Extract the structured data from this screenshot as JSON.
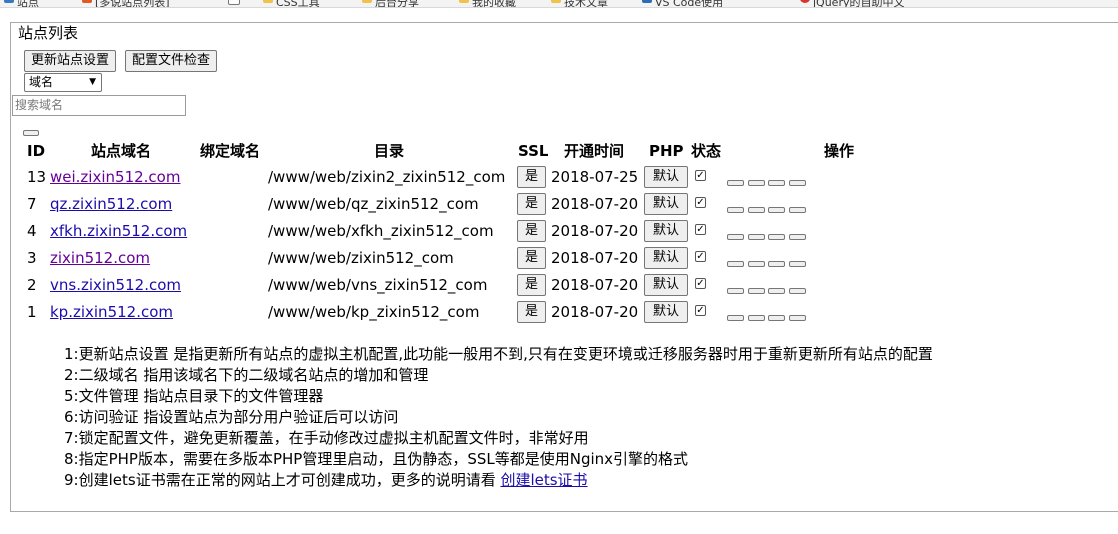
{
  "bookmarks": [
    "站点",
    "[多说站点列表]",
    "CSS工具",
    "后台分享",
    "我的收藏",
    "技术文章",
    "VS Code使用",
    "jQuery的自助中文"
  ],
  "legend": "站点列表",
  "buttons": {
    "update": "更新站点设置",
    "check": "配置文件检查"
  },
  "select": {
    "value": "域名"
  },
  "search": {
    "placeholder": "搜索域名"
  },
  "table": {
    "headers": {
      "id": "ID",
      "domain": "站点域名",
      "bind": "绑定域名",
      "dir": "目录",
      "ssl": "SSL",
      "date": "开通时间",
      "php": "PHP",
      "status": "状态",
      "ops": "操作"
    },
    "rows": [
      {
        "id": "13",
        "domain": "wei.zixin512.com",
        "visited": true,
        "dir": "/www/web/zixin2_zixin512_com",
        "ssl": "是",
        "date": "2018-07-25",
        "php": "默认",
        "status": true
      },
      {
        "id": "7",
        "domain": "qz.zixin512.com",
        "visited": false,
        "dir": "/www/web/qz_zixin512_com",
        "ssl": "是",
        "date": "2018-07-20",
        "php": "默认",
        "status": true
      },
      {
        "id": "4",
        "domain": "xfkh.zixin512.com",
        "visited": false,
        "dir": "/www/web/xfkh_zixin512_com",
        "ssl": "是",
        "date": "2018-07-20",
        "php": "默认",
        "status": true
      },
      {
        "id": "3",
        "domain": "zixin512.com",
        "visited": true,
        "dir": "/www/web/zixin512_com",
        "ssl": "是",
        "date": "2018-07-20",
        "php": "默认",
        "status": true
      },
      {
        "id": "2",
        "domain": "vns.zixin512.com",
        "visited": false,
        "dir": "/www/web/vns_zixin512_com",
        "ssl": "是",
        "date": "2018-07-20",
        "php": "默认",
        "status": true
      },
      {
        "id": "1",
        "domain": "kp.zixin512.com",
        "visited": false,
        "dir": "/www/web/kp_zixin512_com",
        "ssl": "是",
        "date": "2018-07-20",
        "php": "默认",
        "status": true
      }
    ]
  },
  "notes": [
    "1:更新站点设置 是指更新所有站点的虚拟主机配置,此功能一般用不到,只有在变更环境或迁移服务器时用于重新更新所有站点的配置",
    "2:二级域名 指用该域名下的二级域名站点的增加和管理",
    "5:文件管理 指站点目录下的文件管理器",
    "6:访问验证 指设置站点为部分用户验证后可以访问",
    "7:锁定配置文件，避免更新覆盖，在手动修改过虚拟主机配置文件时，非常好用",
    "8:指定PHP版本，需要在多版本PHP管理里启动，且伪静态，SSL等都是使用Nginx引擎的格式",
    "9:创建lets证书需在正常的网站上才可创建成功，更多的说明请看 "
  ],
  "notes_link": "创建lets证书",
  "colors": {
    "link": "#1a0dab",
    "visited": "#660099",
    "button_bg": "#efefef"
  }
}
